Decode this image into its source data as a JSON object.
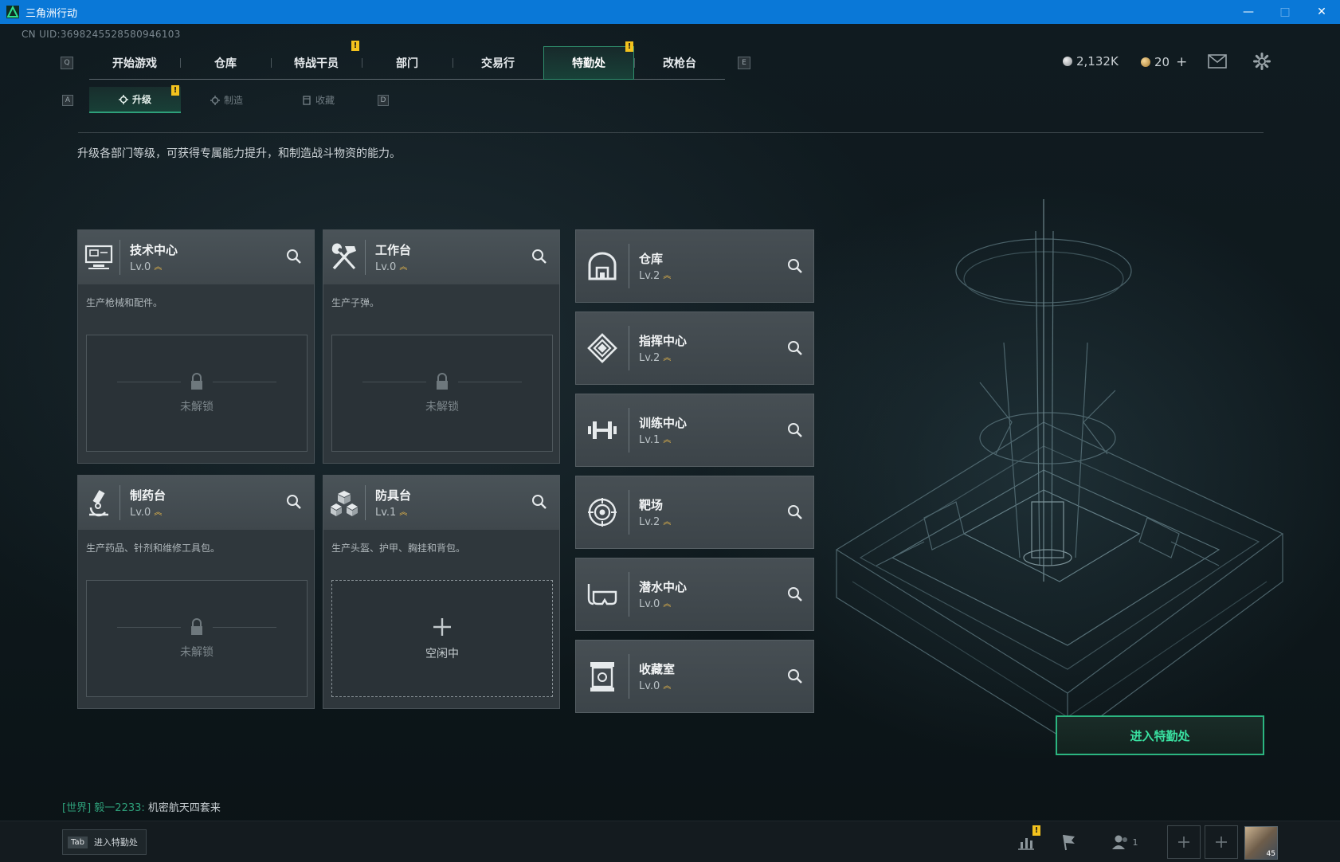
{
  "window": {
    "title": "三角洲行动",
    "minimize": "—",
    "maximize": "□",
    "close": "✕"
  },
  "uid": "CN UID:3698245528580946103",
  "nav": {
    "key_left": "Q",
    "key_right": "E",
    "tabs": [
      {
        "label": "开始游戏"
      },
      {
        "label": "仓库"
      },
      {
        "label": "特战干员",
        "badge": "!"
      },
      {
        "label": "部门"
      },
      {
        "label": "交易行"
      },
      {
        "label": "特勤处",
        "badge": "!",
        "active": true
      },
      {
        "label": "改枪台"
      }
    ]
  },
  "currency": {
    "silver": "2,132K",
    "gold": "20",
    "gold_add": "+"
  },
  "subnav": {
    "key_left": "A",
    "key_right": "D",
    "tabs": [
      {
        "label": "升级",
        "active": true,
        "badge": "!"
      },
      {
        "label": "制造"
      },
      {
        "label": "收藏"
      }
    ]
  },
  "description": "升级各部门等级，可获得专属能力提升，和制造战斗物资的能力。",
  "production": [
    {
      "name": "技术中心",
      "level": "Lv.0",
      "desc": "生产枪械和配件。",
      "slot": "未解锁",
      "state": "locked",
      "icon": "computer-icon"
    },
    {
      "name": "工作台",
      "level": "Lv.0",
      "desc": "生产子弹。",
      "slot": "未解锁",
      "state": "locked",
      "icon": "tools-icon"
    },
    {
      "name": "制药台",
      "level": "Lv.0",
      "desc": "生产药品、针剂和维修工具包。",
      "slot": "未解锁",
      "state": "locked",
      "icon": "microscope-icon"
    },
    {
      "name": "防具台",
      "level": "Lv.1",
      "desc": "生产头盔、护甲、胸挂和背包。",
      "slot": "空闲中",
      "state": "idle",
      "icon": "cubes-icon"
    }
  ],
  "facilities": [
    {
      "name": "仓库",
      "level": "Lv.2",
      "icon": "warehouse-icon"
    },
    {
      "name": "指挥中心",
      "level": "Lv.2",
      "icon": "command-icon"
    },
    {
      "name": "训练中心",
      "level": "Lv.1",
      "icon": "dumbbell-icon"
    },
    {
      "name": "靶场",
      "level": "Lv.2",
      "icon": "target-icon"
    },
    {
      "name": "潜水中心",
      "level": "Lv.0",
      "icon": "diving-mask-icon"
    },
    {
      "name": "收藏室",
      "level": "Lv.0",
      "icon": "collection-icon"
    }
  ],
  "enter_button": "进入特勤处",
  "chat": {
    "channel": "[世界]",
    "user": "毅一2233:",
    "message": "机密航天四套来"
  },
  "bottom": {
    "tab_key": "Tab",
    "tab_label": "进入特勤处",
    "squad_count": "1",
    "avatar_level": "45",
    "stats_badge": "!"
  },
  "colors": {
    "accent_green": "#2ea07a",
    "badge_yellow": "#f3c21d",
    "titlebar_blue": "#0a78d7"
  }
}
